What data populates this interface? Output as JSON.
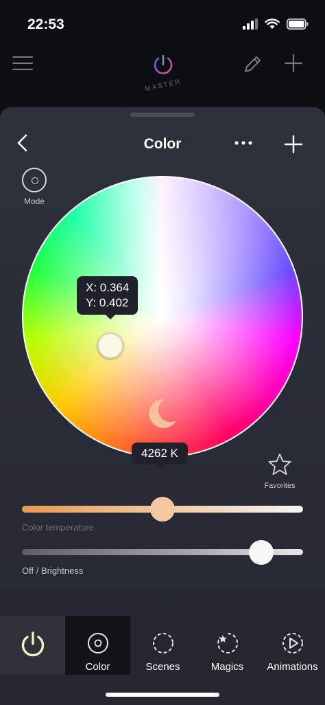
{
  "status": {
    "time": "22:53"
  },
  "top_bar": {
    "center_label": "MASTER"
  },
  "sheet": {
    "title": "Color",
    "mode_label": "Mode",
    "favorites_label": "Favorites"
  },
  "picker": {
    "tooltip_x": "X: 0.364",
    "tooltip_y": "Y: 0.402",
    "kelvin": "4262 K"
  },
  "sliders": {
    "temperature": {
      "label": "Color temperature",
      "value": 0.5
    },
    "brightness": {
      "label": "Off / Brightness",
      "value": 0.85
    }
  },
  "tabs": [
    {
      "label": "",
      "icon": "power-icon"
    },
    {
      "label": "Color",
      "icon": "color-mode-icon",
      "active": true
    },
    {
      "label": "Scenes",
      "icon": "scenes-icon"
    },
    {
      "label": "Magics",
      "icon": "magics-icon"
    },
    {
      "label": "Animations",
      "icon": "animations-icon"
    }
  ],
  "colors": {
    "accent_power": "#f6f0c2",
    "background": "#0d0e12",
    "sheet": "#2d313c"
  }
}
